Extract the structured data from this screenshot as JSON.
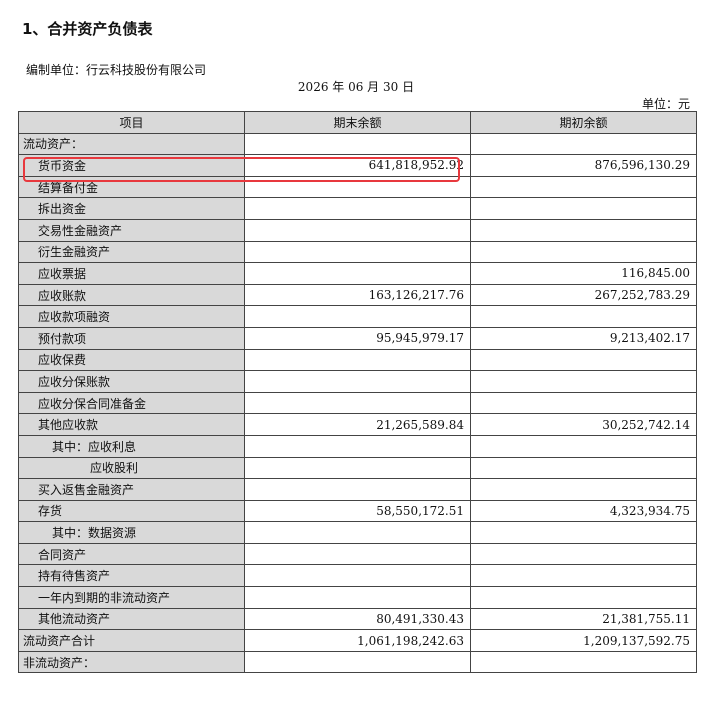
{
  "title": "1、合并资产负债表",
  "company": "编制单位：行云科技股份有限公司",
  "date": "2026 年 06 月 30 日",
  "unit": "单位：元",
  "table": {
    "headers": [
      "项目",
      "期末余额",
      "期初余额"
    ],
    "rows": [
      {
        "label": "流动资产：",
        "level": 0,
        "end": "",
        "begin": ""
      },
      {
        "label": "货币资金",
        "level": 1,
        "end": "641,818,952.92",
        "begin": "876,596,130.29",
        "highlight": true
      },
      {
        "label": "结算备付金",
        "level": 1,
        "end": "",
        "begin": ""
      },
      {
        "label": "拆出资金",
        "level": 1,
        "end": "",
        "begin": ""
      },
      {
        "label": "交易性金融资产",
        "level": 1,
        "end": "",
        "begin": ""
      },
      {
        "label": "衍生金融资产",
        "level": 1,
        "end": "",
        "begin": ""
      },
      {
        "label": "应收票据",
        "level": 1,
        "end": "",
        "begin": "116,845.00"
      },
      {
        "label": "应收账款",
        "level": 1,
        "end": "163,126,217.76",
        "begin": "267,252,783.29"
      },
      {
        "label": "应收款项融资",
        "level": 1,
        "end": "",
        "begin": ""
      },
      {
        "label": "预付款项",
        "level": 1,
        "end": "95,945,979.17",
        "begin": "9,213,402.17"
      },
      {
        "label": "应收保费",
        "level": 1,
        "end": "",
        "begin": ""
      },
      {
        "label": "应收分保账款",
        "level": 1,
        "end": "",
        "begin": ""
      },
      {
        "label": "应收分保合同准备金",
        "level": 1,
        "end": "",
        "begin": ""
      },
      {
        "label": "其他应收款",
        "level": 1,
        "end": "21,265,589.84",
        "begin": "30,252,742.14"
      },
      {
        "label": "其中：应收利息",
        "level": 2,
        "end": "",
        "begin": ""
      },
      {
        "label": "应收股利",
        "level": 3,
        "end": "",
        "begin": ""
      },
      {
        "label": "买入返售金融资产",
        "level": 1,
        "end": "",
        "begin": ""
      },
      {
        "label": "存货",
        "level": 1,
        "end": "58,550,172.51",
        "begin": "4,323,934.75"
      },
      {
        "label": "其中：数据资源",
        "level": 2,
        "end": "",
        "begin": ""
      },
      {
        "label": "合同资产",
        "level": 1,
        "end": "",
        "begin": ""
      },
      {
        "label": "持有待售资产",
        "level": 1,
        "end": "",
        "begin": ""
      },
      {
        "label": "一年内到期的非流动资产",
        "level": 1,
        "end": "",
        "begin": ""
      },
      {
        "label": "其他流动资产",
        "level": 1,
        "end": "80,491,330.43",
        "begin": "21,381,755.11"
      },
      {
        "label": "流动资产合计",
        "level": 0,
        "end": "1,061,198,242.63",
        "begin": "1,209,137,592.75"
      },
      {
        "label": "非流动资产：",
        "level": 0,
        "end": "",
        "begin": ""
      }
    ]
  }
}
